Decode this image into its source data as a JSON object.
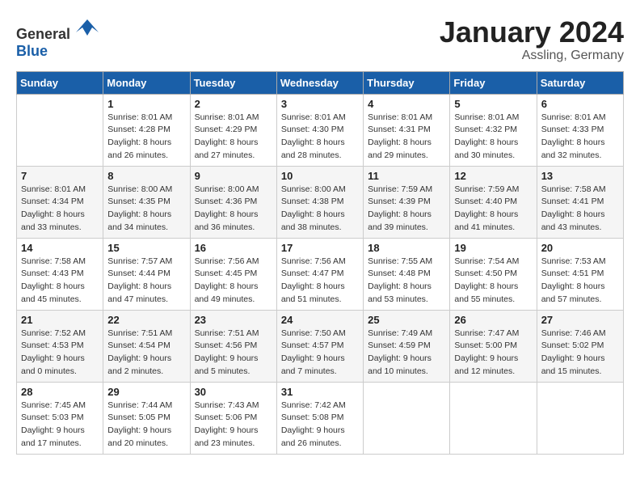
{
  "header": {
    "logo_general": "General",
    "logo_blue": "Blue",
    "month_year": "January 2024",
    "location": "Assling, Germany"
  },
  "days_of_week": [
    "Sunday",
    "Monday",
    "Tuesday",
    "Wednesday",
    "Thursday",
    "Friday",
    "Saturday"
  ],
  "weeks": [
    [
      {
        "day": "",
        "info": ""
      },
      {
        "day": "1",
        "info": "Sunrise: 8:01 AM\nSunset: 4:28 PM\nDaylight: 8 hours\nand 26 minutes."
      },
      {
        "day": "2",
        "info": "Sunrise: 8:01 AM\nSunset: 4:29 PM\nDaylight: 8 hours\nand 27 minutes."
      },
      {
        "day": "3",
        "info": "Sunrise: 8:01 AM\nSunset: 4:30 PM\nDaylight: 8 hours\nand 28 minutes."
      },
      {
        "day": "4",
        "info": "Sunrise: 8:01 AM\nSunset: 4:31 PM\nDaylight: 8 hours\nand 29 minutes."
      },
      {
        "day": "5",
        "info": "Sunrise: 8:01 AM\nSunset: 4:32 PM\nDaylight: 8 hours\nand 30 minutes."
      },
      {
        "day": "6",
        "info": "Sunrise: 8:01 AM\nSunset: 4:33 PM\nDaylight: 8 hours\nand 32 minutes."
      }
    ],
    [
      {
        "day": "7",
        "info": "Sunrise: 8:01 AM\nSunset: 4:34 PM\nDaylight: 8 hours\nand 33 minutes."
      },
      {
        "day": "8",
        "info": "Sunrise: 8:00 AM\nSunset: 4:35 PM\nDaylight: 8 hours\nand 34 minutes."
      },
      {
        "day": "9",
        "info": "Sunrise: 8:00 AM\nSunset: 4:36 PM\nDaylight: 8 hours\nand 36 minutes."
      },
      {
        "day": "10",
        "info": "Sunrise: 8:00 AM\nSunset: 4:38 PM\nDaylight: 8 hours\nand 38 minutes."
      },
      {
        "day": "11",
        "info": "Sunrise: 7:59 AM\nSunset: 4:39 PM\nDaylight: 8 hours\nand 39 minutes."
      },
      {
        "day": "12",
        "info": "Sunrise: 7:59 AM\nSunset: 4:40 PM\nDaylight: 8 hours\nand 41 minutes."
      },
      {
        "day": "13",
        "info": "Sunrise: 7:58 AM\nSunset: 4:41 PM\nDaylight: 8 hours\nand 43 minutes."
      }
    ],
    [
      {
        "day": "14",
        "info": "Sunrise: 7:58 AM\nSunset: 4:43 PM\nDaylight: 8 hours\nand 45 minutes."
      },
      {
        "day": "15",
        "info": "Sunrise: 7:57 AM\nSunset: 4:44 PM\nDaylight: 8 hours\nand 47 minutes."
      },
      {
        "day": "16",
        "info": "Sunrise: 7:56 AM\nSunset: 4:45 PM\nDaylight: 8 hours\nand 49 minutes."
      },
      {
        "day": "17",
        "info": "Sunrise: 7:56 AM\nSunset: 4:47 PM\nDaylight: 8 hours\nand 51 minutes."
      },
      {
        "day": "18",
        "info": "Sunrise: 7:55 AM\nSunset: 4:48 PM\nDaylight: 8 hours\nand 53 minutes."
      },
      {
        "day": "19",
        "info": "Sunrise: 7:54 AM\nSunset: 4:50 PM\nDaylight: 8 hours\nand 55 minutes."
      },
      {
        "day": "20",
        "info": "Sunrise: 7:53 AM\nSunset: 4:51 PM\nDaylight: 8 hours\nand 57 minutes."
      }
    ],
    [
      {
        "day": "21",
        "info": "Sunrise: 7:52 AM\nSunset: 4:53 PM\nDaylight: 9 hours\nand 0 minutes."
      },
      {
        "day": "22",
        "info": "Sunrise: 7:51 AM\nSunset: 4:54 PM\nDaylight: 9 hours\nand 2 minutes."
      },
      {
        "day": "23",
        "info": "Sunrise: 7:51 AM\nSunset: 4:56 PM\nDaylight: 9 hours\nand 5 minutes."
      },
      {
        "day": "24",
        "info": "Sunrise: 7:50 AM\nSunset: 4:57 PM\nDaylight: 9 hours\nand 7 minutes."
      },
      {
        "day": "25",
        "info": "Sunrise: 7:49 AM\nSunset: 4:59 PM\nDaylight: 9 hours\nand 10 minutes."
      },
      {
        "day": "26",
        "info": "Sunrise: 7:47 AM\nSunset: 5:00 PM\nDaylight: 9 hours\nand 12 minutes."
      },
      {
        "day": "27",
        "info": "Sunrise: 7:46 AM\nSunset: 5:02 PM\nDaylight: 9 hours\nand 15 minutes."
      }
    ],
    [
      {
        "day": "28",
        "info": "Sunrise: 7:45 AM\nSunset: 5:03 PM\nDaylight: 9 hours\nand 17 minutes."
      },
      {
        "day": "29",
        "info": "Sunrise: 7:44 AM\nSunset: 5:05 PM\nDaylight: 9 hours\nand 20 minutes."
      },
      {
        "day": "30",
        "info": "Sunrise: 7:43 AM\nSunset: 5:06 PM\nDaylight: 9 hours\nand 23 minutes."
      },
      {
        "day": "31",
        "info": "Sunrise: 7:42 AM\nSunset: 5:08 PM\nDaylight: 9 hours\nand 26 minutes."
      },
      {
        "day": "",
        "info": ""
      },
      {
        "day": "",
        "info": ""
      },
      {
        "day": "",
        "info": ""
      }
    ]
  ]
}
